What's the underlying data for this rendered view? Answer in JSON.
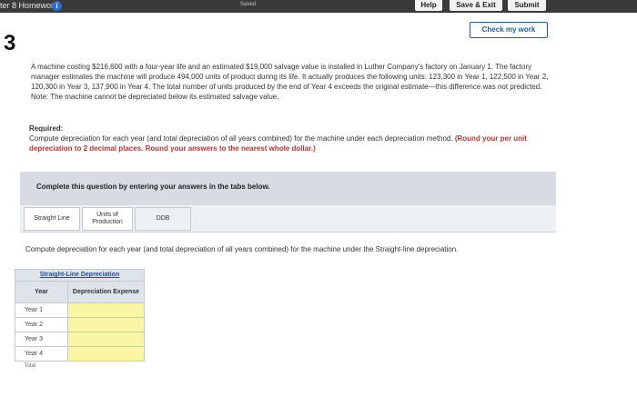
{
  "topbar": {
    "title": "ter 8 Homework",
    "info_icon": "info-icon",
    "saved": "Saved",
    "help": "Help",
    "save_exit": "Save & Exit",
    "submit": "Submit"
  },
  "question_number": "3",
  "check_my_work": "Check my work",
  "problem": {
    "text": "A machine costing $216,600 with a four-year life and an estimated $19,000 salvage value is installed in Luther Company's factory on January 1. The factory manager estimates the machine will produce 494,000 units of product during its life. It actually produces the following units: 123,300 in Year 1, 122,500 in Year 2, 120,300 in Year 3, 137,900 in Year 4. The total number of units produced by the end of Year 4 exceeds the original estimate—this difference was not predicted. Note: The machine cannot be depreciated below its estimated salvage value."
  },
  "required": {
    "header": "Required:",
    "text": "Compute depreciation for each year (and total depreciation of all years combined) for the machine under each depreciation method.",
    "emphasis": "(Round your per unit depreciation to 2 decimal places. Round your answers to the nearest whole dollar.)"
  },
  "banner": "Complete this question by entering your answers in the tabs below.",
  "tabs": [
    {
      "label": "Straight Line"
    },
    {
      "label": "Units of Production"
    },
    {
      "label": "DDB"
    }
  ],
  "instruction": "Compute depreciation for each year (and total depreciation of all years combined) for the machine under the Straight-line depreciation.",
  "table": {
    "caption": "Straight-Line Depreciation",
    "col_year": "Year",
    "col_expense": "Depreciation Expense",
    "rows": [
      {
        "year": "Year 1",
        "value": ""
      },
      {
        "year": "Year 2",
        "value": ""
      },
      {
        "year": "Year 3",
        "value": ""
      },
      {
        "year": "Year 4",
        "value": ""
      }
    ],
    "cut_label": "Total"
  }
}
